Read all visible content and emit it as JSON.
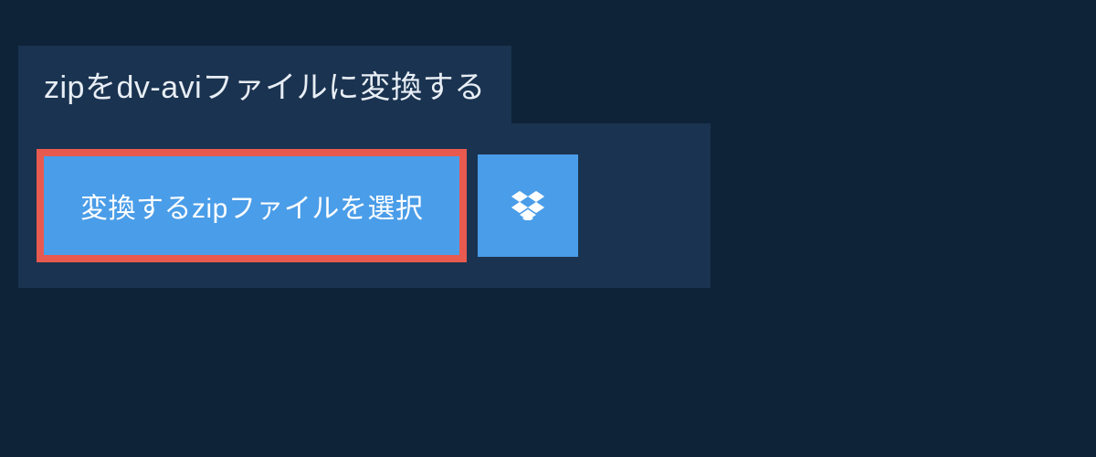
{
  "header": {
    "title_prefix": "zip",
    "title_middle": "を",
    "title_format": "dv-avi",
    "title_suffix": "ファイルに変換する"
  },
  "upload": {
    "select_button_label": "変換するzipファイルを選択"
  }
}
